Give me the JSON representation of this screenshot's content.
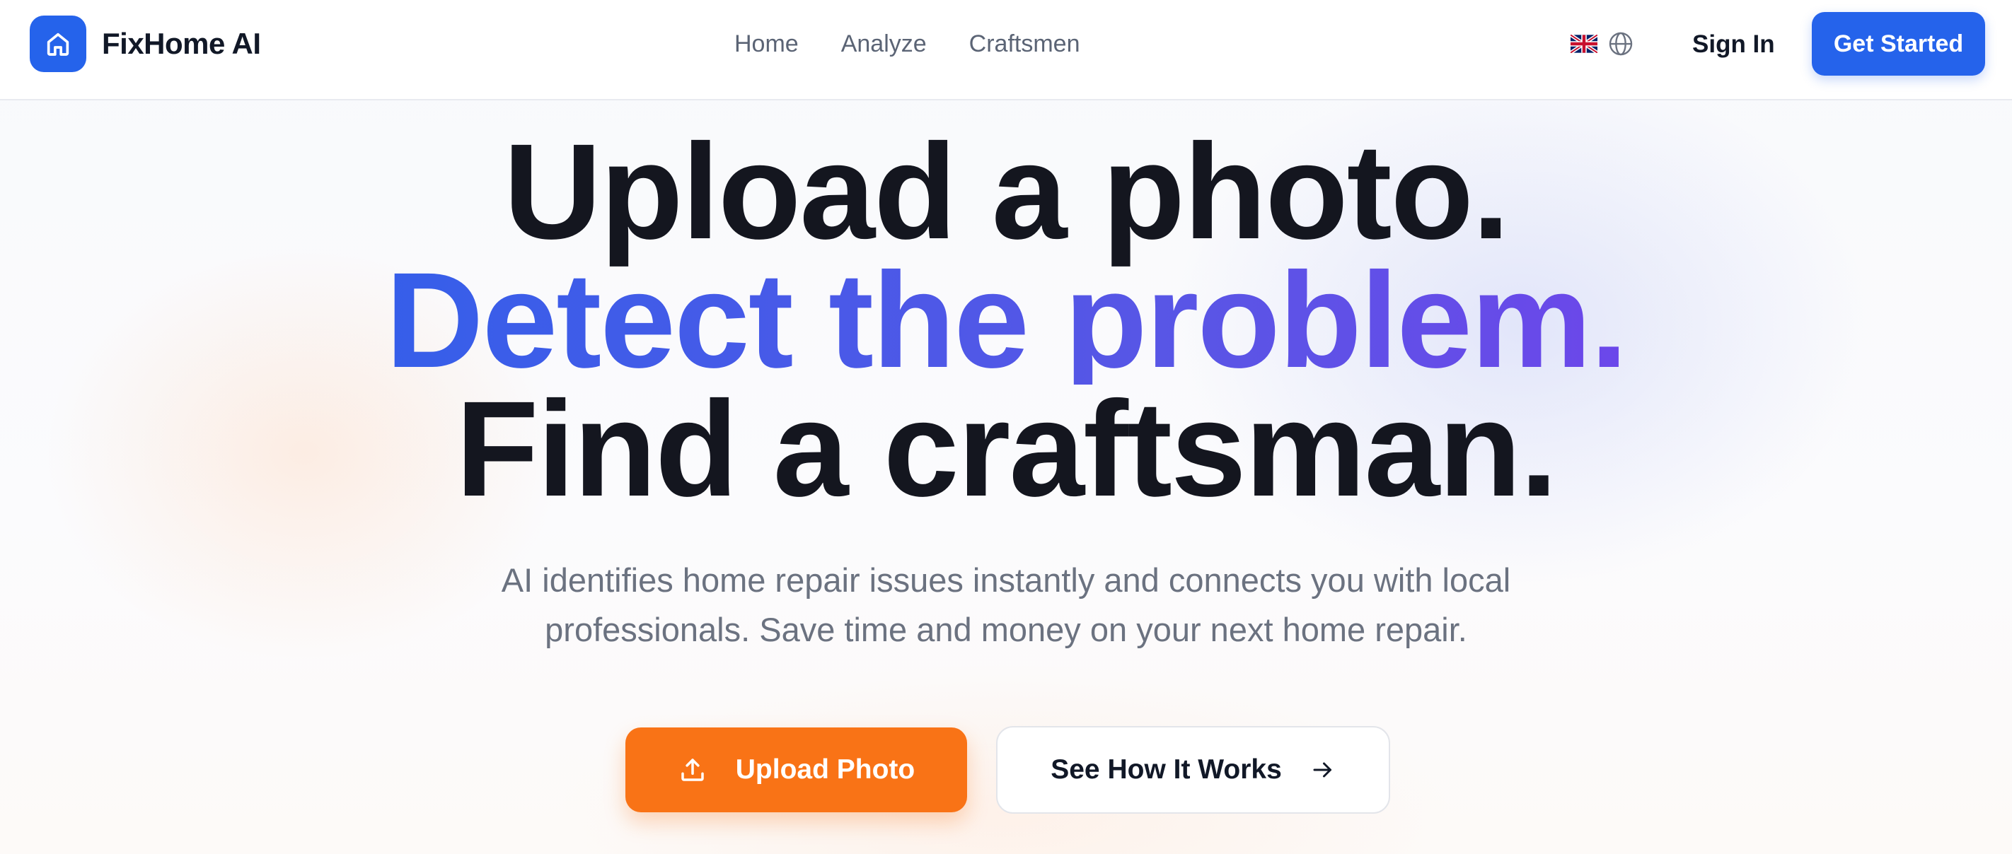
{
  "header": {
    "brand": "FixHome AI",
    "nav": [
      "Home",
      "Analyze",
      "Craftsmen"
    ],
    "language_flag": "uk-flag",
    "signin_label": "Sign In",
    "cta_label": "Get Started"
  },
  "hero": {
    "line1": "Upload a photo.",
    "line2": "Detect the problem.",
    "line3": "Find a craftsman.",
    "subtitle_line1": "AI identifies home repair issues instantly and connects you with local",
    "subtitle_line2": "professionals. Save time and money on your next home repair.",
    "primary_button": "Upload Photo",
    "secondary_button": "See How It Works"
  },
  "colors": {
    "brand_blue": "#2563eb",
    "accent_orange": "#f97316",
    "gradient_start": "#2563eb",
    "gradient_end": "#7c3aed",
    "text_dark": "#14161f",
    "text_muted": "#6b7280"
  },
  "icons": {
    "logo": "home-icon",
    "language": "globe-icon",
    "upload": "upload-icon",
    "arrow": "arrow-right-icon"
  }
}
